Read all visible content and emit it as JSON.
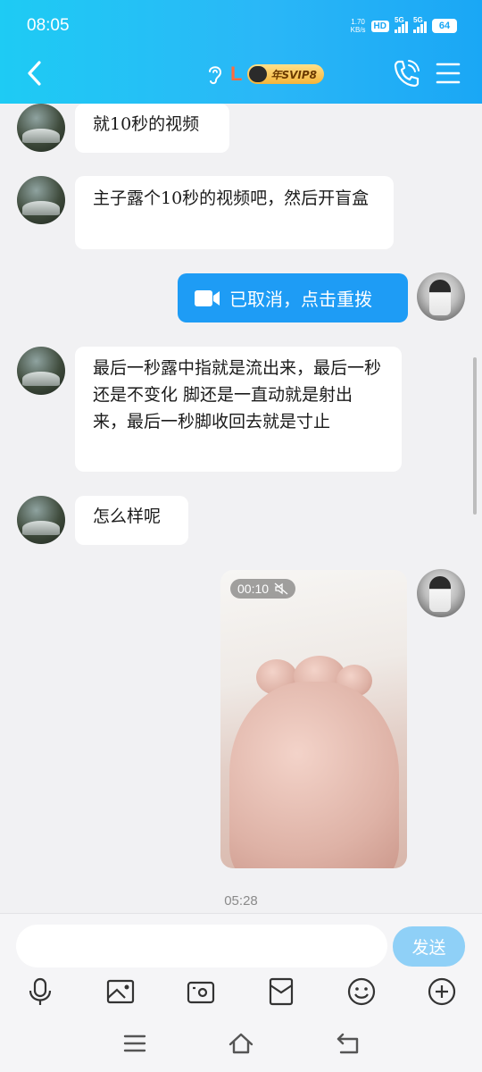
{
  "status_bar": {
    "time": "08:05",
    "net_speed_value": "1.70",
    "net_speed_unit": "KB/s",
    "hd_label": "HD",
    "signal_1_label": "5G",
    "signal_2_label": "5G",
    "battery": "64"
  },
  "header": {
    "contact_name": "L",
    "vip_label": "年SVIP8"
  },
  "messages": {
    "m1": "就10秒的视频",
    "m2": "主子露个10秒的视频吧，然后开盲盒",
    "m3": "已取消，点击重拨",
    "m4": "最后一秒露中指就是流出来，最后一秒还是不变化 脚还是一直动就是射出来，最后一秒脚收回去就是寸止",
    "m5": "怎么样呢",
    "video_duration": "00:10",
    "timestamp": "05:28"
  },
  "input": {
    "placeholder": "",
    "send_label": "发送"
  },
  "colors": {
    "header_start": "#1ecbf4",
    "header_end": "#1aa7f5",
    "video_call_bubble": "#1e9cf5",
    "send_button": "#8fd0f7",
    "contact_name": "#ff6b3d"
  },
  "icons": {
    "toolbar": [
      "microphone-icon",
      "image-icon",
      "camera-icon",
      "red-packet-icon",
      "emoji-icon",
      "plus-icon"
    ],
    "nav": [
      "menu-lines-icon",
      "home-icon",
      "back-arrow-icon"
    ]
  }
}
